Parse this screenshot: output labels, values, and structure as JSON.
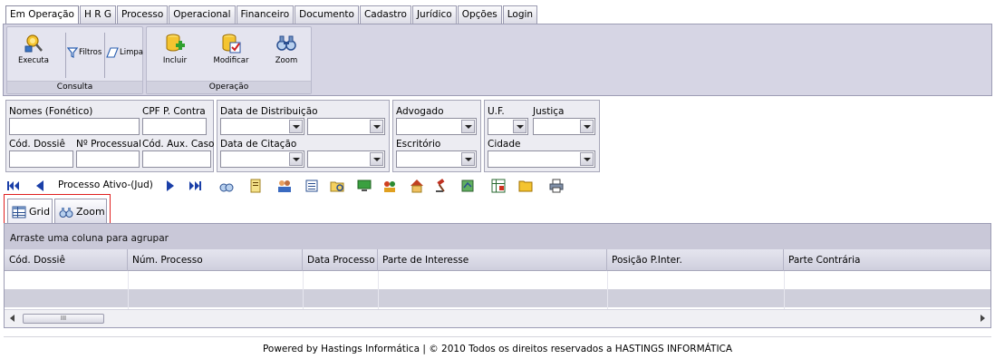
{
  "menu": {
    "tabs": [
      {
        "label": "Em Operação"
      },
      {
        "label": "H R G"
      },
      {
        "label": "Processo"
      },
      {
        "label": "Operacional"
      },
      {
        "label": "Financeiro"
      },
      {
        "label": "Documento"
      },
      {
        "label": "Cadastro"
      },
      {
        "label": "Jurídico"
      },
      {
        "label": "Opções"
      },
      {
        "label": "Login"
      }
    ]
  },
  "ribbon": {
    "consulta": {
      "group_label": "Consulta",
      "executa": "Executa",
      "filtros": "Filtros",
      "limpa": "Limpa"
    },
    "operacao": {
      "group_label": "Operação",
      "incluir": "Incluir",
      "modificar": "Modificar",
      "zoom": "Zoom"
    }
  },
  "filters": {
    "nomes_label": "Nomes (Fonético)",
    "cpf_label": "CPF P. Contra",
    "cod_dossie_label": "Cód. Dossiê",
    "num_processual_label": "Nº Processual",
    "cod_aux_label": "Cód. Aux. Caso",
    "data_distribuicao_label": "Data de Distribuição",
    "data_citacao_label": "Data de Citação",
    "advogado_label": "Advogado",
    "escritorio_label": "Escritório",
    "uf_label": "U.F.",
    "justica_label": "Justiça",
    "cidade_label": "Cidade"
  },
  "nav": {
    "label": "Processo Ativo-(Jud)"
  },
  "view_tabs": {
    "grid": "Grid",
    "zoom": "Zoom"
  },
  "grid": {
    "group_hint": "Arraste uma coluna para agrupar",
    "columns": [
      "Cód. Dossiê",
      "Núm. Processo",
      "Data Processo",
      "Parte de Interesse",
      "Posição P.Inter.",
      "Parte Contrária"
    ],
    "scroll_thumb": "III"
  },
  "footer": {
    "text": "Powered by Hastings Informática | © 2010 Todos os direitos reservados a HASTINGS INFORMÁTICA"
  },
  "colors": {
    "ribbon_bg": "#d6d5e4",
    "highlight_border": "#e02020",
    "grid_header": "#c9c8d8"
  }
}
